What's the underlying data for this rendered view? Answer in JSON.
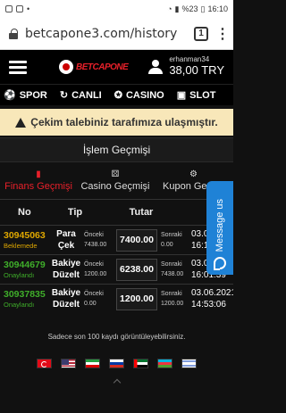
{
  "status_bar": {
    "right_text": "%23",
    "time": "16:10"
  },
  "browser": {
    "url": "betcapone3.com/history",
    "tab_count": "1",
    "menu_glyph": "⋮"
  },
  "header": {
    "logo_text": "BETCAPONE",
    "username": "erhanman34",
    "balance": "38,00 TRY"
  },
  "nav": [
    {
      "label": "SPOR",
      "icon": "⚽"
    },
    {
      "label": "CANLI",
      "icon": "↻"
    },
    {
      "label": "CASINO",
      "icon": "✪"
    },
    {
      "label": "SLOT",
      "icon": "▣"
    }
  ],
  "alert": {
    "text": "Çekim talebiniz tarafımıza ulaşmıştır."
  },
  "page_title": "İşlem Geçmişi",
  "tabs": [
    {
      "label": "Finans Geçmişi",
      "active": true
    },
    {
      "label": "Casino Geçmişi",
      "active": false
    },
    {
      "label": "Kupon Geçmişi",
      "active": false
    }
  ],
  "table": {
    "headers": {
      "no": "No",
      "type": "Tip",
      "amount": "Tutar"
    },
    "rows": [
      {
        "no": "30945063",
        "status": "Beklemede",
        "status_color": "#e0a800",
        "type1": "Para",
        "type2": "Çek",
        "prev_label": "Önceki",
        "prev_value": "7438.00",
        "amount": "7400.00",
        "next_label": "Sonraki",
        "next_value": "0.00",
        "date1": "03.06.2021",
        "date2": "16:10:15"
      },
      {
        "no": "30944679",
        "status": "Onaylandı",
        "status_color": "#3fae2a",
        "type1": "Bakiye",
        "type2": "Düzelt",
        "prev_label": "Önceki",
        "prev_value": "1200.00",
        "amount": "6238.00",
        "next_label": "Sonraki",
        "next_value": "7438.00",
        "date1": "03.06.2021",
        "date2": "16:01:39"
      },
      {
        "no": "30937835",
        "status": "Onaylandı",
        "status_color": "#3fae2a",
        "type1": "Bakiye",
        "type2": "Düzelt",
        "prev_label": "Önceki",
        "prev_value": "0.00",
        "amount": "1200.00",
        "next_label": "Sonraki",
        "next_value": "1200.00",
        "date1": "03.06.2021",
        "date2": "14:53:06"
      }
    ]
  },
  "note": "Sadece son 100 kaydı görüntüleyebilirsiniz.",
  "flags": [
    "tr",
    "us",
    "ir",
    "ru",
    "ae",
    "az",
    "il"
  ],
  "message_button": {
    "label": "Message us"
  },
  "colors": {
    "accent_red": "#e8202a",
    "alert_bg": "#f8e7b9",
    "message_blue": "#1f82d6"
  }
}
